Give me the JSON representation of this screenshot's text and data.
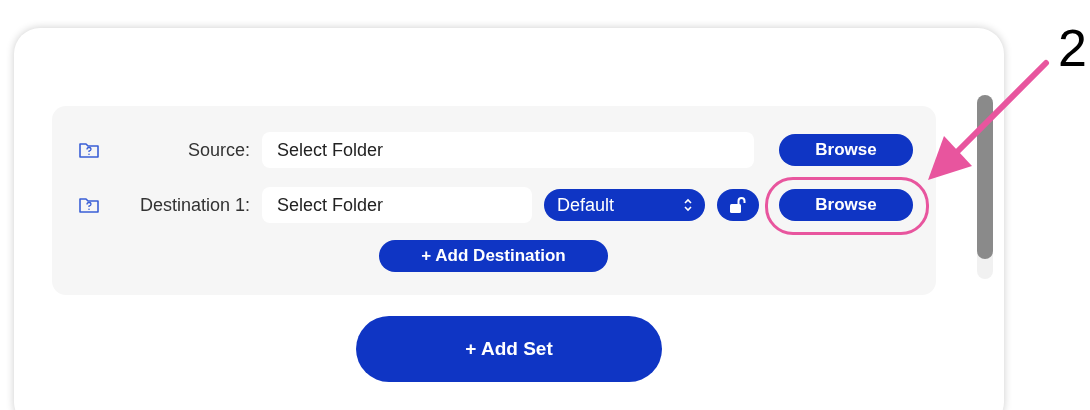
{
  "sets": [
    {
      "rows": [
        {
          "kind": "source",
          "label": "Source:",
          "placeholder": "Select Folder",
          "button": "Browse"
        },
        {
          "kind": "destination",
          "label": "Destination 1:",
          "placeholder": "Select Folder",
          "preset": "Default",
          "locked": false,
          "button": "Browse",
          "highlighted": true
        }
      ],
      "add_destination": "+ Add Destination"
    }
  ],
  "add_set": "+ Add Set",
  "callout": {
    "number": "2"
  }
}
